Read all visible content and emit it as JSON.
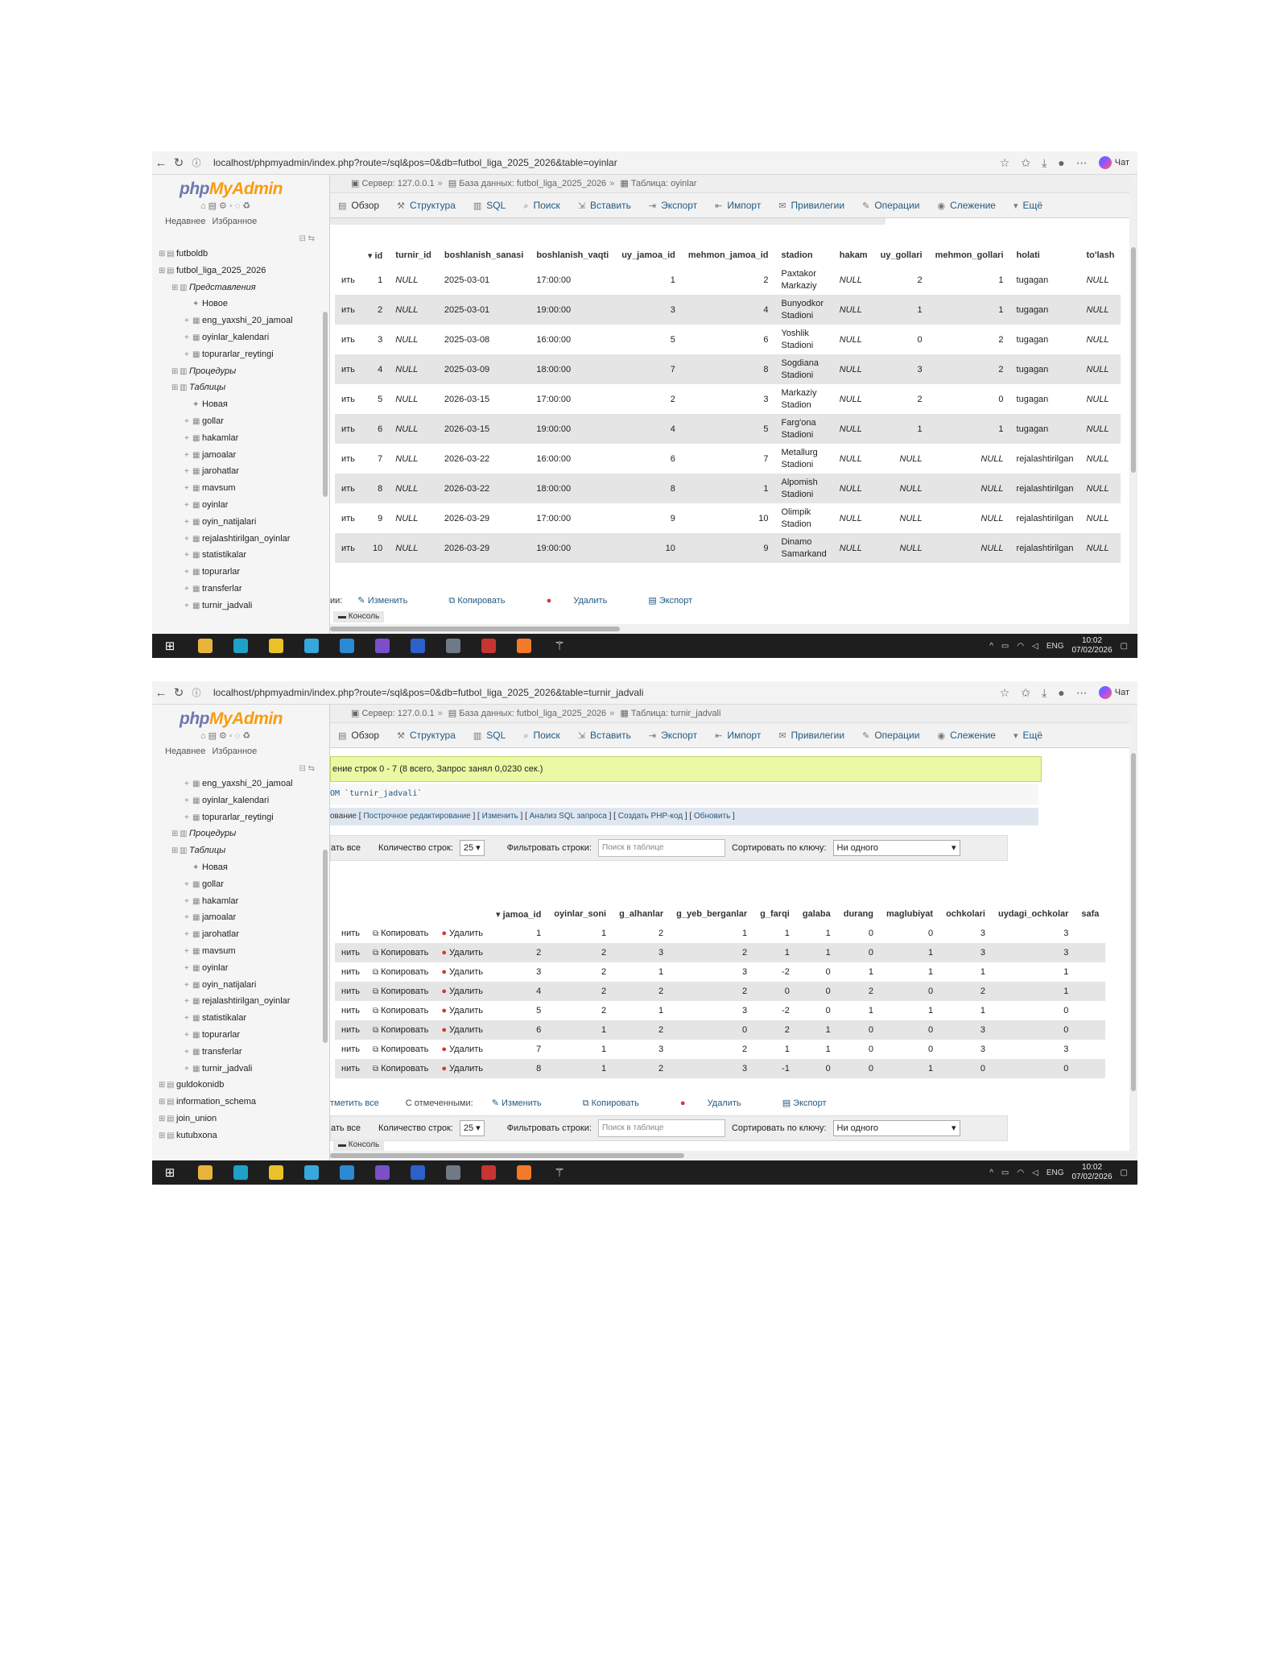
{
  "browser": {
    "url_top": "localhost/phpmyadmin/index.php?route=/sql&pos=0&db=futbol_liga_2025_2026&table=oyinlar",
    "url_bottom": "localhost/phpmyadmin/index.php?route=/sql&pos=0&db=futbol_liga_2025_2026&table=turnir_jadvali",
    "chat_label": "Чат"
  },
  "pma": {
    "logo_php": "php",
    "logo_my": "MyAdmin",
    "recent": "Недавнее",
    "favorites": "Избранное",
    "server": "Сервер: 127.0.0.1",
    "database": "База данных: futbol_liga_2025_2026",
    "table_top": "Таблица: oyinlar",
    "table_bottom": "Таблица: turnir_jadvali",
    "tabs": [
      "Обзор",
      "Структура",
      "SQL",
      "Поиск",
      "Вставить",
      "Экспорт",
      "Импорт",
      "Привилегии",
      "Операции",
      "Слежение",
      "Ещё"
    ],
    "console": "Консоль"
  },
  "tree_top": [
    {
      "label": "futboldb",
      "level": 0,
      "kind": "db"
    },
    {
      "label": "futbol_liga_2025_2026",
      "level": 0,
      "kind": "db"
    },
    {
      "label": "Представления",
      "level": 1,
      "kind": "group"
    },
    {
      "label": "Новое",
      "level": 2,
      "kind": "new"
    },
    {
      "label": "eng_yaxshi_20_jamoal",
      "level": 2,
      "kind": "item"
    },
    {
      "label": "oyinlar_kalendari",
      "level": 2,
      "kind": "item"
    },
    {
      "label": "topurarlar_reytingi",
      "level": 2,
      "kind": "item"
    },
    {
      "label": "Процедуры",
      "level": 1,
      "kind": "group"
    },
    {
      "label": "Таблицы",
      "level": 1,
      "kind": "group"
    },
    {
      "label": "Новая",
      "level": 2,
      "kind": "new"
    },
    {
      "label": "gollar",
      "level": 2,
      "kind": "item"
    },
    {
      "label": "hakamlar",
      "level": 2,
      "kind": "item"
    },
    {
      "label": "jamoalar",
      "level": 2,
      "kind": "item"
    },
    {
      "label": "jarohatlar",
      "level": 2,
      "kind": "item"
    },
    {
      "label": "mavsum",
      "level": 2,
      "kind": "item"
    },
    {
      "label": "oyinlar",
      "level": 2,
      "kind": "item"
    },
    {
      "label": "oyin_natijalari",
      "level": 2,
      "kind": "item"
    },
    {
      "label": "rejalashtirilgan_oyinlar",
      "level": 2,
      "kind": "item"
    },
    {
      "label": "statistikalar",
      "level": 2,
      "kind": "item"
    },
    {
      "label": "topurarlar",
      "level": 2,
      "kind": "item"
    },
    {
      "label": "transferlar",
      "level": 2,
      "kind": "item"
    },
    {
      "label": "turnir_jadvali",
      "level": 2,
      "kind": "item"
    }
  ],
  "tree_bottom": [
    {
      "label": "eng_yaxshi_20_jamoal",
      "level": 2,
      "kind": "item"
    },
    {
      "label": "oyinlar_kalendari",
      "level": 2,
      "kind": "item"
    },
    {
      "label": "topurarlar_reytingi",
      "level": 2,
      "kind": "item"
    },
    {
      "label": "Процедуры",
      "level": 1,
      "kind": "group"
    },
    {
      "label": "Таблицы",
      "level": 1,
      "kind": "group"
    },
    {
      "label": "Новая",
      "level": 2,
      "kind": "new"
    },
    {
      "label": "gollar",
      "level": 2,
      "kind": "item"
    },
    {
      "label": "hakamlar",
      "level": 2,
      "kind": "item"
    },
    {
      "label": "jamoalar",
      "level": 2,
      "kind": "item"
    },
    {
      "label": "jarohatlar",
      "level": 2,
      "kind": "item"
    },
    {
      "label": "mavsum",
      "level": 2,
      "kind": "item"
    },
    {
      "label": "oyinlar",
      "level": 2,
      "kind": "item"
    },
    {
      "label": "oyin_natijalari",
      "level": 2,
      "kind": "item"
    },
    {
      "label": "rejalashtirilgan_oyinlar",
      "level": 2,
      "kind": "item"
    },
    {
      "label": "statistikalar",
      "level": 2,
      "kind": "item"
    },
    {
      "label": "topurarlar",
      "level": 2,
      "kind": "item"
    },
    {
      "label": "transferlar",
      "level": 2,
      "kind": "item"
    },
    {
      "label": "turnir_jadvali",
      "level": 2,
      "kind": "item"
    },
    {
      "label": "guldokonidb",
      "level": 0,
      "kind": "db"
    },
    {
      "label": "information_schema",
      "level": 0,
      "kind": "db"
    },
    {
      "label": "join_union",
      "level": 0,
      "kind": "db"
    },
    {
      "label": "kutubxona",
      "level": 0,
      "kind": "db"
    }
  ],
  "oyinlar": {
    "columns": [
      "id",
      "turnir_id",
      "boshlanish_sanasi",
      "boshlanish_vaqti",
      "uy_jamoa_id",
      "mehmon_jamoa_id",
      "stadion",
      "hakam",
      "uy_gollari",
      "mehmon_gollari",
      "holati",
      "to'lash"
    ],
    "edit_stub": "ить",
    "rows": [
      [
        "1",
        "NULL",
        "2025-03-01",
        "17:00:00",
        "1",
        "2",
        "Paxtakor Markaziy",
        "NULL",
        "2",
        "1",
        "tugagan",
        "NULL"
      ],
      [
        "2",
        "NULL",
        "2025-03-01",
        "19:00:00",
        "3",
        "4",
        "Bunyodkor Stadioni",
        "NULL",
        "1",
        "1",
        "tugagan",
        "NULL"
      ],
      [
        "3",
        "NULL",
        "2025-03-08",
        "16:00:00",
        "5",
        "6",
        "Yoshlik Stadioni",
        "NULL",
        "0",
        "2",
        "tugagan",
        "NULL"
      ],
      [
        "4",
        "NULL",
        "2025-03-09",
        "18:00:00",
        "7",
        "8",
        "Sogdiana Stadioni",
        "NULL",
        "3",
        "2",
        "tugagan",
        "NULL"
      ],
      [
        "5",
        "NULL",
        "2026-03-15",
        "17:00:00",
        "2",
        "3",
        "Markaziy Stadion",
        "NULL",
        "2",
        "0",
        "tugagan",
        "NULL"
      ],
      [
        "6",
        "NULL",
        "2026-03-15",
        "19:00:00",
        "4",
        "5",
        "Farg'ona Stadioni",
        "NULL",
        "1",
        "1",
        "tugagan",
        "NULL"
      ],
      [
        "7",
        "NULL",
        "2026-03-22",
        "16:00:00",
        "6",
        "7",
        "Metallurg Stadioni",
        "NULL",
        "NULL",
        "NULL",
        "rejalashtirilgan",
        "NULL"
      ],
      [
        "8",
        "NULL",
        "2026-03-22",
        "18:00:00",
        "8",
        "1",
        "Alpomish Stadioni",
        "NULL",
        "NULL",
        "NULL",
        "rejalashtirilgan",
        "NULL"
      ],
      [
        "9",
        "NULL",
        "2026-03-29",
        "17:00:00",
        "9",
        "10",
        "Olimpik Stadion",
        "NULL",
        "NULL",
        "NULL",
        "rejalashtirilgan",
        "NULL"
      ],
      [
        "10",
        "NULL",
        "2026-03-29",
        "19:00:00",
        "10",
        "9",
        "Dinamo Samarkand",
        "NULL",
        "NULL",
        "NULL",
        "rejalashtirilgan",
        "NULL"
      ]
    ],
    "bottom": {
      "stub": "ии:",
      "edit": "Изменить",
      "copy": "Копировать",
      "delete": "Удалить",
      "export": "Экспорт"
    }
  },
  "turnir": {
    "success": "ение строк 0 - 7 (8 всего, Запрос занял 0,0230 сек.)",
    "sql": "OM `turnir_jadvali`",
    "links_prefix": "ование [",
    "links": [
      "Построчное редактирование",
      "Изменить",
      "Анализ SQL запроса",
      "Создать PHP-код",
      "Обновить"
    ],
    "nav": {
      "stub": "ать все",
      "rows_label": "Количество строк:",
      "rows_value": "25",
      "filter_label": "Фильтровать строки:",
      "filter_placeholder": "Поиск в таблице",
      "sort_label": "Сортировать по ключу:",
      "sort_value": "Ни одного"
    },
    "columns": [
      "jamoa_id",
      "oyinlar_soni",
      "g_alhanlar",
      "g_yeb_berganlar",
      "g_farqi",
      "galaba",
      "durang",
      "maglubiyat",
      "ochkolari",
      "uydagi_ochkolar",
      "safa"
    ],
    "edit_stub": "нить",
    "copy": "Копировать",
    "delete": "Удалить",
    "rows": [
      [
        "1",
        "1",
        "2",
        "1",
        "1",
        "1",
        "0",
        "0",
        "3",
        "3"
      ],
      [
        "2",
        "2",
        "3",
        "2",
        "1",
        "1",
        "0",
        "1",
        "3",
        "3"
      ],
      [
        "3",
        "2",
        "1",
        "3",
        "-2",
        "0",
        "1",
        "1",
        "1",
        "1"
      ],
      [
        "4",
        "2",
        "2",
        "2",
        "0",
        "0",
        "2",
        "0",
        "2",
        "1"
      ],
      [
        "5",
        "2",
        "1",
        "3",
        "-2",
        "0",
        "1",
        "1",
        "1",
        "0"
      ],
      [
        "6",
        "1",
        "2",
        "0",
        "2",
        "1",
        "0",
        "0",
        "3",
        "0"
      ],
      [
        "7",
        "1",
        "3",
        "2",
        "1",
        "1",
        "0",
        "0",
        "3",
        "3"
      ],
      [
        "8",
        "1",
        "2",
        "3",
        "-1",
        "0",
        "0",
        "1",
        "0",
        "0"
      ]
    ],
    "bottom": {
      "check_all": "тметить все",
      "with_selected": "С отмеченными:",
      "edit": "Изменить",
      "copy": "Копировать",
      "delete": "Удалить",
      "export": "Экспорт"
    }
  },
  "taskbar": {
    "lang": "ENG",
    "time": "10:02",
    "date": "07/02/2026"
  }
}
